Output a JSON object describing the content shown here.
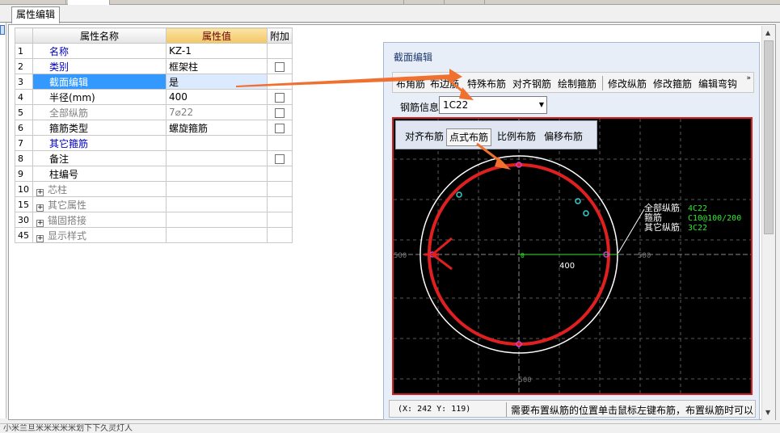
{
  "tab": {
    "label": "属性编辑"
  },
  "grid": {
    "headers": {
      "name": "属性名称",
      "value": "属性值",
      "extra": "附加"
    },
    "rows": [
      {
        "num": "1",
        "name": "名称",
        "value": "KZ-1"
      },
      {
        "num": "2",
        "name": "类别",
        "value": "框架柱"
      },
      {
        "num": "3",
        "name": "截面编辑",
        "value": "是"
      },
      {
        "num": "4",
        "name": "半径(mm)",
        "value": "400"
      },
      {
        "num": "5",
        "name": "全部纵筋",
        "value": "7⌀22"
      },
      {
        "num": "6",
        "name": "箍筋类型",
        "value": "螺旋箍筋"
      },
      {
        "num": "7",
        "name": "其它箍筋",
        "value": ""
      },
      {
        "num": "8",
        "name": "备注",
        "value": ""
      },
      {
        "num": "9",
        "name": "柱编号",
        "value": ""
      },
      {
        "num": "10",
        "name": "芯柱",
        "value": ""
      },
      {
        "num": "15",
        "name": "其它属性",
        "value": ""
      },
      {
        "num": "30",
        "name": "锚固搭接",
        "value": ""
      },
      {
        "num": "45",
        "name": "显示样式",
        "value": ""
      }
    ]
  },
  "panel": {
    "title": "截面编辑",
    "toolbar": [
      "布角筋",
      "布边筋",
      "特殊布筋",
      "对齐钢筋",
      "绘制箍筋",
      "修改纵筋",
      "修改箍筋",
      "编辑弯钩"
    ],
    "more": "»",
    "rebar_label": "钢筋信息",
    "rebar_value": "1C22",
    "float_toolbar": [
      "对齐布筋",
      "点式布筋",
      "比例布筋",
      "偏移布筋"
    ],
    "coordinates": "(X: 242 Y: 119)",
    "hint": "需要布置纵筋的位置单击鼠标左键布筋，布置纵筋时可以",
    "canvas": {
      "dim_radius": "400",
      "left_tick": "500",
      "right_tick": "500",
      "bottom_tick": "-500",
      "origin_tick": "0",
      "annotations": [
        {
          "label": "全部纵筋",
          "value": "4C22"
        },
        {
          "label": "箍筋",
          "value": "C10@100/200"
        },
        {
          "label": "其它纵筋",
          "value": "3C22"
        }
      ]
    }
  },
  "statusbar": {
    "text": "小米兰旦米米米米米划下下久灵灯人"
  },
  "colors": {
    "accent_red": "#e02020",
    "arrow_orange": "#f07030",
    "selection_blue": "#3399ff",
    "annotation_green": "#2ee82e"
  }
}
